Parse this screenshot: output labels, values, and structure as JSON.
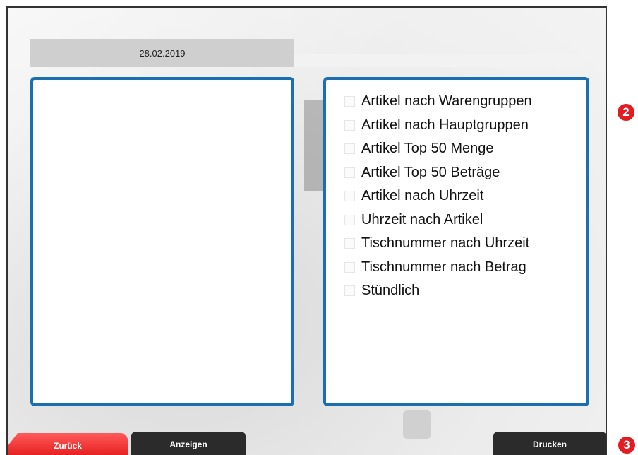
{
  "date": "28.02.2019",
  "reports": [
    {
      "label": "Artikel nach Warengruppen",
      "checked": false
    },
    {
      "label": "Artikel nach Hauptgruppen",
      "checked": false
    },
    {
      "label": "Artikel Top 50 Menge",
      "checked": false
    },
    {
      "label": "Artikel Top 50 Beträge",
      "checked": false
    },
    {
      "label": "Artikel nach Uhrzeit",
      "checked": false
    },
    {
      "label": "Uhrzeit nach Artikel",
      "checked": false
    },
    {
      "label": "Tischnummer nach Uhrzeit",
      "checked": false
    },
    {
      "label": "Tischnummer nach Betrag",
      "checked": false
    },
    {
      "label": "Stündlich",
      "checked": false
    }
  ],
  "buttons": {
    "back": "Zurück",
    "show": "Anzeigen",
    "print": "Drucken"
  },
  "callouts": {
    "two": "2",
    "three": "3"
  },
  "colors": {
    "panel_border": "#1b6fb0",
    "back_button": "#e41a1a",
    "dark_button": "#2b2b2b",
    "callout": "#e31b23"
  }
}
